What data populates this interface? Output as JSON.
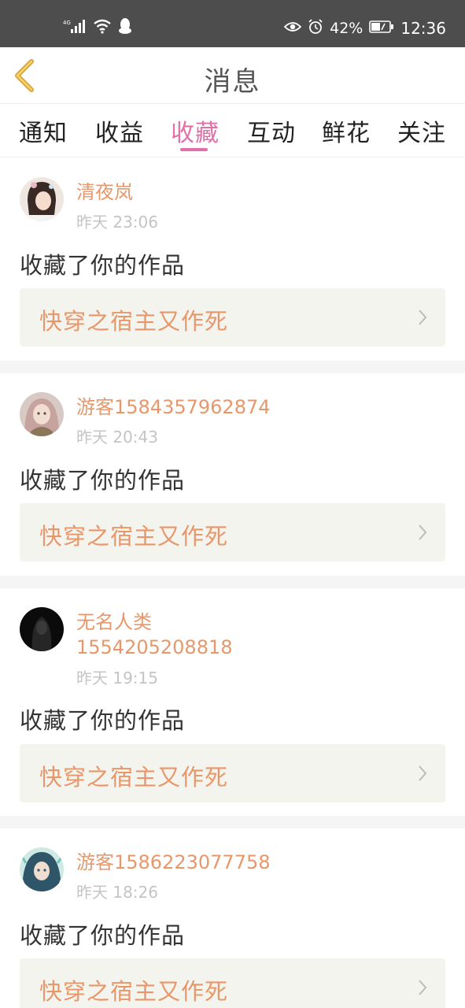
{
  "status_bar": {
    "network": "4G",
    "battery": "42%",
    "time": "12:36"
  },
  "nav": {
    "title": "消息"
  },
  "tabs": [
    {
      "label": "通知",
      "active": false
    },
    {
      "label": "收益",
      "active": false
    },
    {
      "label": "收藏",
      "active": true
    },
    {
      "label": "互动",
      "active": false
    },
    {
      "label": "鲜花",
      "active": false
    },
    {
      "label": "关注",
      "active": false
    }
  ],
  "colors": {
    "accent": "#e36fa8",
    "username": "#e8976a",
    "work_title": "#e8976a",
    "status_bar": "#4d4d4d"
  },
  "messages": [
    {
      "username": "清夜岚",
      "time": "昨天 23:06",
      "action": "收藏了你的作品",
      "work": "快穿之宿主又作死"
    },
    {
      "username": "游客1584357962874",
      "time": "昨天 20:43",
      "action": "收藏了你的作品",
      "work": "快穿之宿主又作死"
    },
    {
      "username_line1": "无名人类",
      "username_line2": "1554205208818",
      "time": "昨天 19:15",
      "action": "收藏了你的作品",
      "work": "快穿之宿主又作死"
    },
    {
      "username": "游客1586223077758",
      "time": "昨天 18:26",
      "action": "收藏了你的作品",
      "work": "快穿之宿主又作死"
    }
  ]
}
